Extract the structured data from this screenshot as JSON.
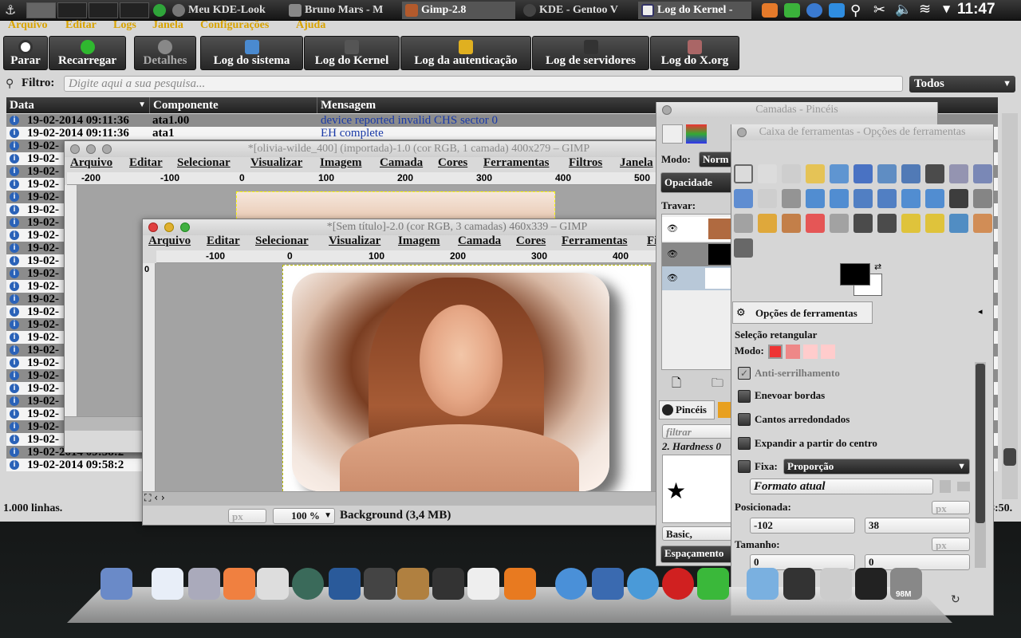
{
  "panel": {
    "tasks": [
      {
        "label": "Meu KDE-Look",
        "color": "#666"
      },
      {
        "label": "Bruno Mars - M",
        "color": "#777"
      },
      {
        "label": "Gimp-2.8",
        "color": "#b35a2c"
      },
      {
        "label": "KDE - Gentoo V",
        "color": "#444"
      },
      {
        "label": "Log do Kernel -",
        "color": "#336"
      }
    ],
    "clock": "11:47"
  },
  "ksystemlog": {
    "menu": [
      "Arquivo",
      "Editar",
      "Logs",
      "Janela",
      "Configurações",
      "Ajuda"
    ],
    "toolbar": [
      "Parar",
      "Recarregar",
      "Detalhes",
      "Log do sistema",
      "Log do Kernel",
      "Log da autenticação",
      "Log de servidores",
      "Log do X.org"
    ],
    "filter_label": "Filtro:",
    "filter_placeholder": "Digite aqui a sua pesquisa...",
    "filter_select": "Todos",
    "columns": [
      "Data",
      "Componente",
      "Mensagem"
    ],
    "rows": [
      {
        "date": "19-02-2014 09:11:36",
        "component": "ata1.00",
        "message": "device reported invalid CHS sector 0"
      },
      {
        "date": "19-02-2014 09:11:36",
        "component": "ata1",
        "message": "EH complete"
      },
      {
        "date": "19-02-",
        "component": "",
        "message": ""
      },
      {
        "date": "19-02-",
        "component": "",
        "message": ""
      },
      {
        "date": "19-02-",
        "component": "",
        "message": ""
      },
      {
        "date": "19-02-",
        "component": "",
        "message": ""
      },
      {
        "date": "19-02-",
        "component": "",
        "message": ""
      },
      {
        "date": "19-02-",
        "component": "",
        "message": ""
      },
      {
        "date": "19-02-",
        "component": "",
        "message": ""
      },
      {
        "date": "19-02-",
        "component": "",
        "message": ""
      },
      {
        "date": "19-02-",
        "component": "",
        "message": ""
      },
      {
        "date": "19-02-",
        "component": "",
        "message": ""
      },
      {
        "date": "19-02-",
        "component": "",
        "message": ""
      },
      {
        "date": "19-02-",
        "component": "",
        "message": ""
      },
      {
        "date": "19-02-",
        "component": "",
        "message": ""
      },
      {
        "date": "19-02-",
        "component": "",
        "message": ""
      },
      {
        "date": "19-02-",
        "component": "",
        "message": ""
      },
      {
        "date": "19-02-",
        "component": "",
        "message": ""
      },
      {
        "date": "19-02-",
        "component": "",
        "message": ""
      },
      {
        "date": "19-02-",
        "component": "",
        "message": ""
      },
      {
        "date": "19-02-",
        "component": "",
        "message": ""
      },
      {
        "date": "19-02-",
        "component": "",
        "message": ""
      },
      {
        "date": "19-02-",
        "component": "",
        "message": ""
      },
      {
        "date": "19-02-",
        "component": "",
        "message": ""
      },
      {
        "date": "19-02-",
        "component": "",
        "message": ""
      },
      {
        "date": "19-02-",
        "component": "",
        "message": ""
      },
      {
        "date": "19-02-2014 09:58:2",
        "component": "",
        "message": ""
      },
      {
        "date": "19-02-2014 09:58:2",
        "component": "",
        "message": ""
      }
    ],
    "status": "1.000 linhas.",
    "status_right": "8:50."
  },
  "gimp_back": {
    "title": "*[olivia-wilde_400] (importada)-1.0 (cor RGB, 1 camada) 400x279 – GIMP",
    "menu": [
      "Arquivo",
      "Editar",
      "Selecionar",
      "Visualizar",
      "Imagem",
      "Camada",
      "Cores",
      "Ferramentas",
      "Filtros",
      "Janela"
    ],
    "ruler": [
      "-200",
      "-100",
      "0",
      "100",
      "200",
      "300",
      "400",
      "500"
    ]
  },
  "gimp_front": {
    "title": "*[Sem título]-2.0 (cor RGB, 3 camadas) 460x339 – GIMP",
    "menu": [
      "Arquivo",
      "Editar",
      "Selecionar",
      "Visualizar",
      "Imagem",
      "Camada",
      "Cores",
      "Ferramentas",
      "Fi"
    ],
    "ruler": [
      "-100",
      "0",
      "100",
      "200",
      "300",
      "400"
    ],
    "unit": "px",
    "zoom": "100 %",
    "status": "Background (3,4 MB)"
  },
  "layers_dock": {
    "title": "Camadas - Pincéis",
    "mode_label": "Modo:",
    "mode_value": "Norm",
    "opacity_label": "Opacidade",
    "lock_label": "Travar:",
    "brushes_tab": "Pincéis",
    "filter_placeholder": "filtrar",
    "brush_name": "2. Hardness 0",
    "basic": "Basic,",
    "spacing": "Espaçamento"
  },
  "toolbox": {
    "title": "Caixa de ferramentas - Opções de ferramentas",
    "tab": "Opções de ferramentas",
    "tool_name": "Seleção retangular",
    "mode_label": "Modo:",
    "options": [
      "Anti-serrilhamento",
      "Enevoar bordas",
      "Cantos arredondados",
      "Expandir a partir do centro"
    ],
    "fixed_label": "Fixa:",
    "fixed_value": "Proporção",
    "format": "Formato atual",
    "position_label": "Posicionada:",
    "pos_x": "-102",
    "pos_y": "38",
    "size_label": "Tamanho:",
    "size_w": "0",
    "size_h": "0",
    "unit": "px"
  },
  "dock": {
    "trash_label": "98M"
  }
}
